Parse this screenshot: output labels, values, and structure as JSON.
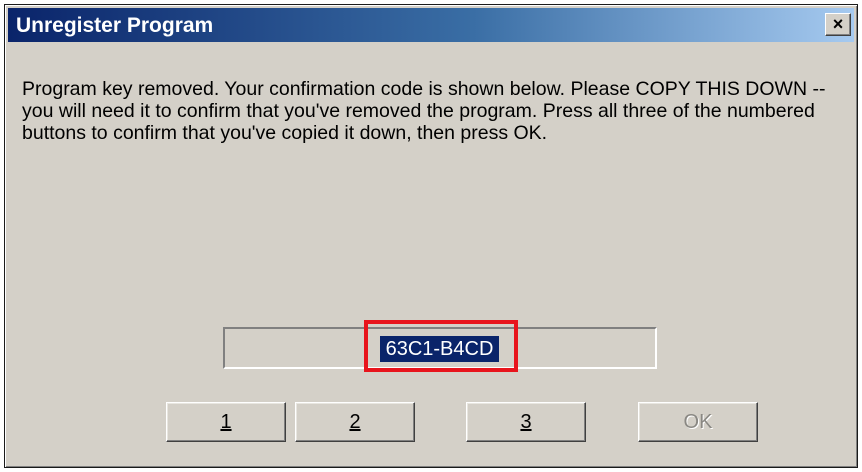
{
  "window": {
    "title": "Unregister Program",
    "close_glyph": "×"
  },
  "message": "Program key removed. Your confirmation code is shown below. Please COPY THIS DOWN -- you will need it to confirm that you've removed the program. Press all three of the numbered buttons to confirm that you've copied it down, then press OK.",
  "confirmation_code": "63C1-B4CD",
  "buttons": {
    "b1": "1",
    "b2": "2",
    "b3": "3",
    "ok": "OK"
  },
  "colors": {
    "title_gradient_start": "#0a246a",
    "title_gradient_end": "#a6caf0",
    "face": "#d4d0c8",
    "selection": "#0a246a",
    "highlight_annotation": "#e8141c"
  }
}
